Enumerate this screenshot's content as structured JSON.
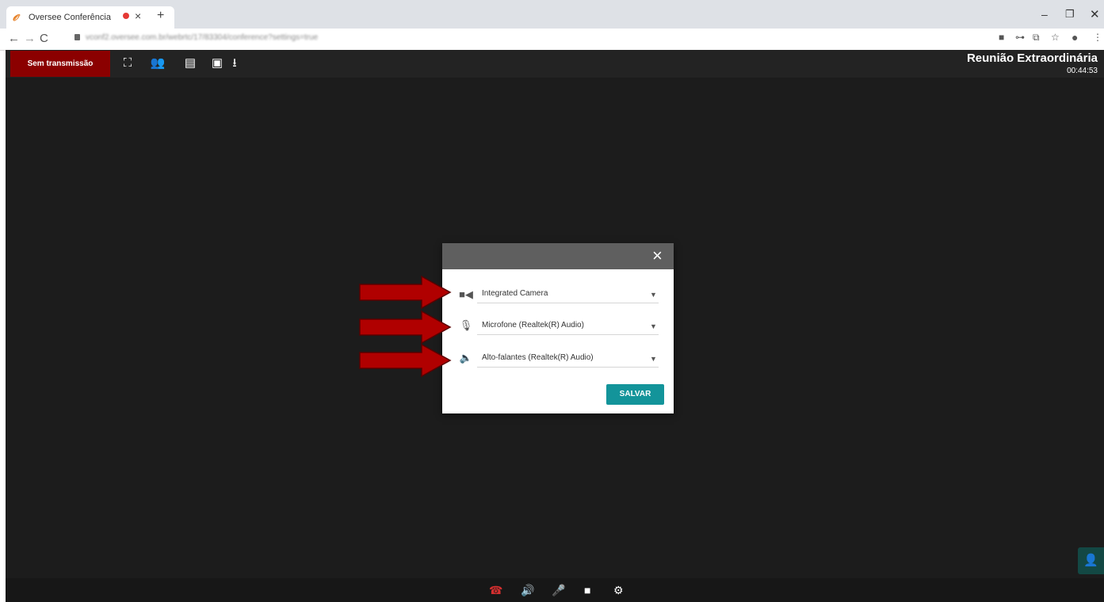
{
  "browser": {
    "tab_title": "Oversee Conferência",
    "favicon": "oversee-logo",
    "tab_close_label": "×",
    "new_tab_label": "+",
    "url": "vconf2.oversee.com.br/webrtc/17/83304/conference?settings=true",
    "window_min": "–",
    "window_restore": "❐",
    "window_close": "✕",
    "nav_back": "←",
    "nav_forward": "→",
    "nav_reload": "C",
    "extensions": [
      "■",
      "⊶",
      "⧉",
      "☆",
      "●",
      "⋮"
    ]
  },
  "app": {
    "stream_button": "Sem transmissão",
    "toolbar_icons": [
      "fullscreen-icon",
      "participants-icon",
      "chat-icon",
      "present-icon",
      "download-icon"
    ],
    "toolbar_glyphs": [
      "⛶",
      "👥",
      "▤",
      "▣",
      "⭳"
    ],
    "meeting_title": "Reunião Extraordinária",
    "meeting_time": "00:44:53",
    "accent_color": "#8b0000",
    "bottom_glyphs": [
      "☎",
      "🔊",
      "🎤",
      "■",
      "⚙"
    ],
    "add_participant_glyph": "👤"
  },
  "dialog": {
    "close_label": "×",
    "camera": "Integrated Camera",
    "microphone": "Microfone (Realtek(R) Audio)",
    "speaker": "Alto-falantes (Realtek(R) Audio)",
    "caret": "▼",
    "save_label": "SALVAR",
    "save_color": "#13949a"
  },
  "annotations": {
    "arrow_color": "#b00000",
    "arrow_count": 3
  }
}
